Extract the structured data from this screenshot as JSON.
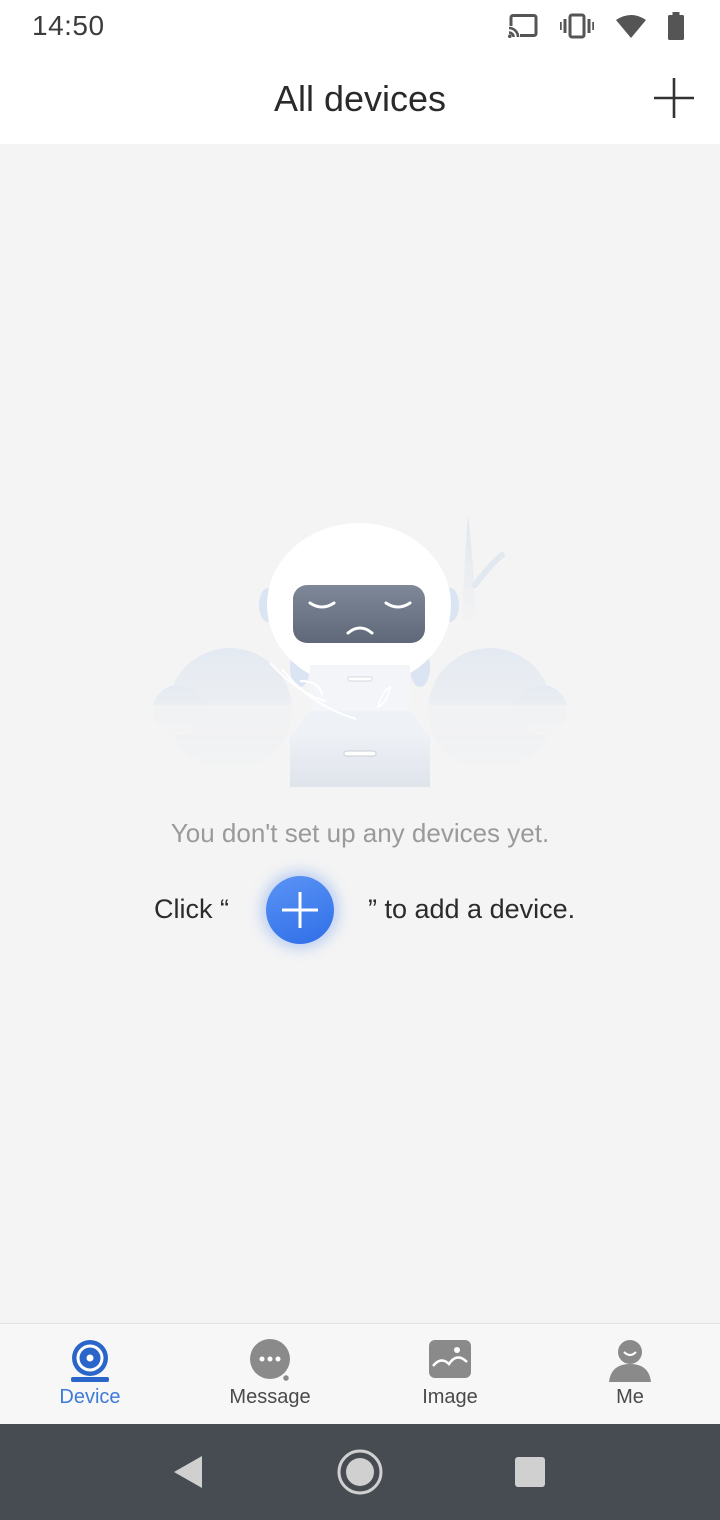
{
  "status_bar": {
    "time": "14:50",
    "icons": [
      "cast-icon",
      "vibrate-icon",
      "wifi-icon",
      "battery-icon"
    ]
  },
  "header": {
    "title": "All devices",
    "add_icon": "plus-icon"
  },
  "empty_state": {
    "message": "You don't set up any devices yet.",
    "hint_prefix": "Click “",
    "hint_suffix": "” to add a device.",
    "hint_icon": "plus-icon"
  },
  "tabs": [
    {
      "label": "Device",
      "icon": "camera-icon",
      "active": true
    },
    {
      "label": "Message",
      "icon": "message-icon",
      "active": false
    },
    {
      "label": "Image",
      "icon": "image-icon",
      "active": false
    },
    {
      "label": "Me",
      "icon": "person-icon",
      "active": false
    }
  ],
  "colors": {
    "accent": "#3e7bd8",
    "background": "#f4f4f4",
    "nav_bar": "#474b52",
    "inactive_icon": "#8a8a8a"
  }
}
